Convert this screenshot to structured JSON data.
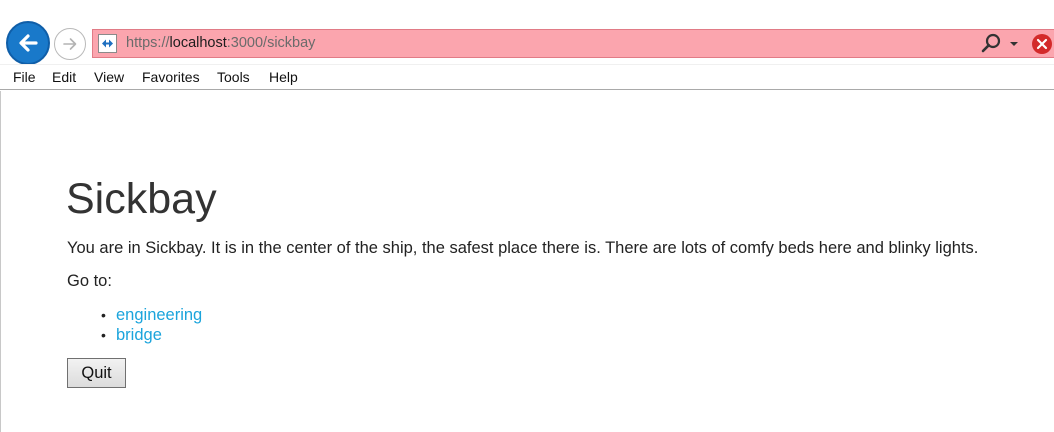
{
  "browser": {
    "url_scheme": "https://",
    "url_host": "localhost",
    "url_rest": ":3000/sickbay",
    "address_bar_color": "#fba5ae",
    "icons": [
      "back-arrow-icon",
      "forward-arrow-icon",
      "site-icon",
      "search-icon",
      "dropdown-icon",
      "stop-icon"
    ]
  },
  "menubar": {
    "items": [
      "File",
      "Edit",
      "View",
      "Favorites",
      "Tools",
      "Help"
    ]
  },
  "page": {
    "title": "Sickbay",
    "description": "You are in Sickbay. It is in the center of the ship, the safest place there is. There are lots of comfy beds here and blinky lights.",
    "goto_label": "Go to:",
    "links": [
      "engineering",
      "bridge"
    ],
    "link_color": "#1ba4dc",
    "quit_label": "Quit"
  }
}
